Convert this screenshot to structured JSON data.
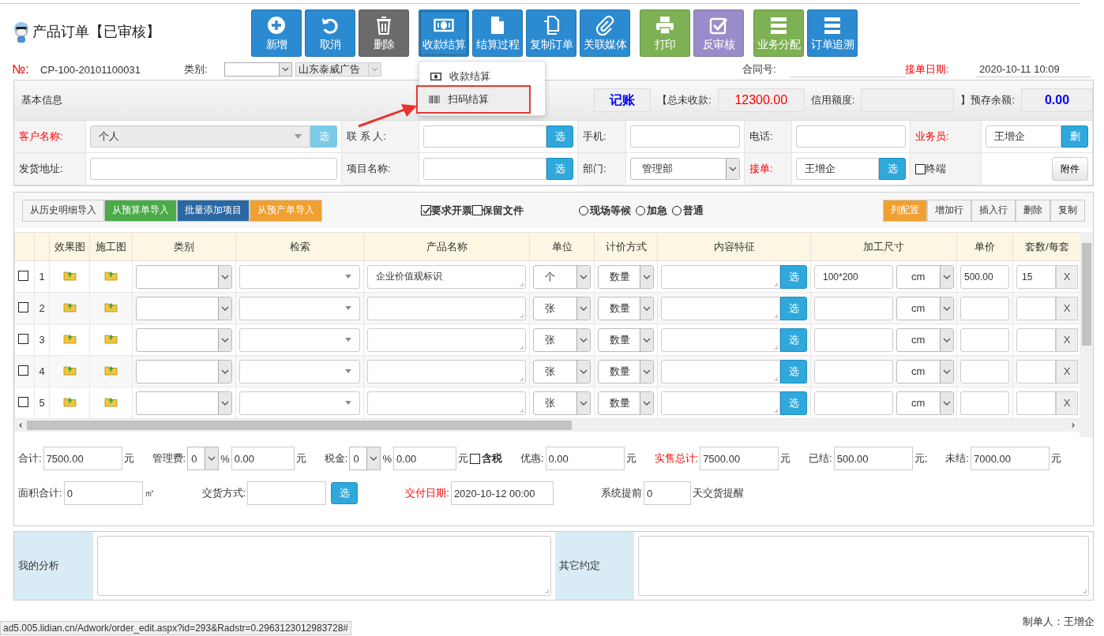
{
  "page": {
    "title": "产品订单【已审核】"
  },
  "toolbar": [
    [
      {
        "label": "新增",
        "color": "#2b8ad0",
        "expanded": false
      },
      {
        "label": "取消",
        "color": "#2b8ad0",
        "expanded": false
      },
      {
        "label": "删除",
        "color": "#6b6b6b",
        "expanded": false
      }
    ],
    [
      {
        "label": "收款结算",
        "color": "#2b8ad0",
        "expanded": true
      },
      {
        "label": "结算过程",
        "color": "#2b8ad0",
        "expanded": false
      },
      {
        "label": "复制订单",
        "color": "#2b8ad0",
        "expanded": false
      },
      {
        "label": "关联媒体",
        "color": "#2b8ad0",
        "expanded": false
      }
    ],
    [
      {
        "label": "打印",
        "color": "#7db153",
        "expanded": false
      },
      {
        "label": "反审核",
        "color": "#9a8cc8",
        "expanded": false
      }
    ],
    [
      {
        "label": "业务分配",
        "color": "#7db153",
        "expanded": false
      },
      {
        "label": "订单追溯",
        "color": "#2b8ad0",
        "expanded": false
      }
    ]
  ],
  "menu": [
    {
      "label": "收款结算",
      "selected": false
    },
    {
      "label": "扫码结算",
      "selected": true
    }
  ],
  "order_line": {
    "no_label": "№:",
    "no": "CP-100-20101100031",
    "category_label": "类别:",
    "company": "山东泰威广告",
    "contract_label": "合同号:",
    "date_label": "接单日期:",
    "date": "2020-10-11 10:09"
  },
  "info_bar": {
    "title": "基本信息",
    "mode": "记账",
    "unpaid_label": "【总未收款:",
    "unpaid": "12300.00",
    "credit_label": "信用额度:",
    "balance_label": "】预存余额:",
    "balance": "0.00"
  },
  "form": {
    "rows": [
      [
        {
          "label": "客户名称:",
          "required": true,
          "kind": "combo",
          "disabled": true,
          "value": "个人",
          "button": "选"
        },
        {
          "label": "联 系 人:",
          "required": false,
          "kind": "input",
          "button": "选"
        },
        {
          "label": "手机:",
          "required": false,
          "kind": "input"
        },
        {
          "label": "电话:",
          "required": false,
          "kind": "input"
        },
        {
          "label": "业务员:",
          "required": true,
          "kind": "input",
          "value": "王增企",
          "button": "删"
        }
      ],
      [
        {
          "label": "发货地址:",
          "required": false,
          "kind": "input"
        },
        {
          "label": "项目名称:",
          "required": false,
          "kind": "input",
          "button": "选"
        },
        {
          "label": "部门:",
          "required": false,
          "kind": "select",
          "value": "管理部"
        },
        {
          "label": "接单:",
          "required": true,
          "kind": "input",
          "value": "王增企",
          "button": "选"
        },
        {
          "label": "终端",
          "required": false,
          "kind": "checkbox",
          "checked": false,
          "button": "附件"
        }
      ]
    ]
  },
  "table_toolbar": {
    "imports": [
      {
        "label": "从历史明细导入",
        "color": "#f4f4f4"
      },
      {
        "label": "从预算单导入",
        "color": "#4caa48"
      },
      {
        "label": "批量添加项目",
        "color": "#2a68a3"
      },
      {
        "label": "从预产单导入",
        "color": "#f0a030"
      }
    ],
    "options": [
      {
        "label": "要求开票",
        "checked": true
      },
      {
        "label": "保留文件",
        "checked": false
      }
    ],
    "urgency": [
      {
        "label": "现场等候",
        "selected": false
      },
      {
        "label": "加急",
        "selected": false
      },
      {
        "label": "普通",
        "selected": false
      }
    ],
    "actions": [
      {
        "label": "列配置",
        "color": "#f0a030"
      },
      {
        "label": "增加行",
        "color": "#f4f4f4"
      },
      {
        "label": "插入行",
        "color": "#f4f4f4"
      },
      {
        "label": "删除",
        "color": "#f4f4f4"
      },
      {
        "label": "复制",
        "color": "#f4f4f4"
      }
    ]
  },
  "table": {
    "columns": [
      "效果图",
      "施工图",
      "类别",
      "检索",
      "产品名称",
      "单位",
      "计价方式",
      "内容特征",
      "加工尺寸",
      "单价",
      "套数/每套"
    ],
    "rows": [
      {
        "checked": false,
        "no": "1",
        "product": "企业价值观标识",
        "unit": "个",
        "pricing": "数量",
        "pick": "选",
        "size": "100*200",
        "size_unit": "cm",
        "price": "500.00",
        "sets": "15",
        "remove": "X"
      },
      {
        "checked": false,
        "no": "2",
        "unit": "张",
        "pricing": "数量",
        "pick": "选",
        "size_unit": "cm",
        "remove": "X"
      },
      {
        "checked": false,
        "no": "3",
        "unit": "张",
        "pricing": "数量",
        "pick": "选",
        "size_unit": "cm",
        "remove": "X"
      },
      {
        "checked": false,
        "no": "4",
        "unit": "张",
        "pricing": "数量",
        "pick": "选",
        "size_unit": "cm",
        "remove": "X"
      },
      {
        "checked": false,
        "no": "5",
        "unit": "张",
        "pricing": "数量",
        "pick": "选",
        "size_unit": "cm",
        "remove": "X"
      }
    ]
  },
  "totals": [
    [
      {
        "label": "合计:",
        "value": "7500.00",
        "unit": "元"
      },
      {
        "label": "管理费:",
        "select": "0",
        "percent": "%",
        "value": "0.00",
        "unit": "元"
      },
      {
        "label": "税金:",
        "select": "0",
        "percent": "%",
        "value": "0.00",
        "unit": "元",
        "checkbox": {
          "label": "含税",
          "checked": false
        }
      },
      {
        "label": "优惠:",
        "value": "0.00",
        "unit": "元"
      },
      {
        "label": "实售总计:",
        "required": true,
        "value": "7500.00",
        "unit": "元"
      },
      {
        "label": "已结:",
        "value": "500.00",
        "unit": "元;"
      },
      {
        "label": "未结:",
        "value": "7000.00",
        "unit": "元"
      }
    ],
    [
      {
        "label": "面积合计:",
        "value": "0",
        "unit": "㎡"
      },
      {
        "label": "交货方式:",
        "button": "选"
      },
      {
        "label": "交付日期:",
        "required": true,
        "value": "2020-10-12 00:00",
        "kind": "date"
      },
      {
        "label": "系统提前",
        "value": "0",
        "unit": "天交货提醒",
        "kind": "short"
      }
    ]
  ],
  "notes": [
    {
      "label": "我的分析"
    },
    {
      "label": "其它约定"
    }
  ],
  "status_url": "ad5.005.lidian.cn/Adwork/order_edit.aspx?id=293&Radstr=0.2963123012983728#",
  "creator": "制单人：王增企"
}
